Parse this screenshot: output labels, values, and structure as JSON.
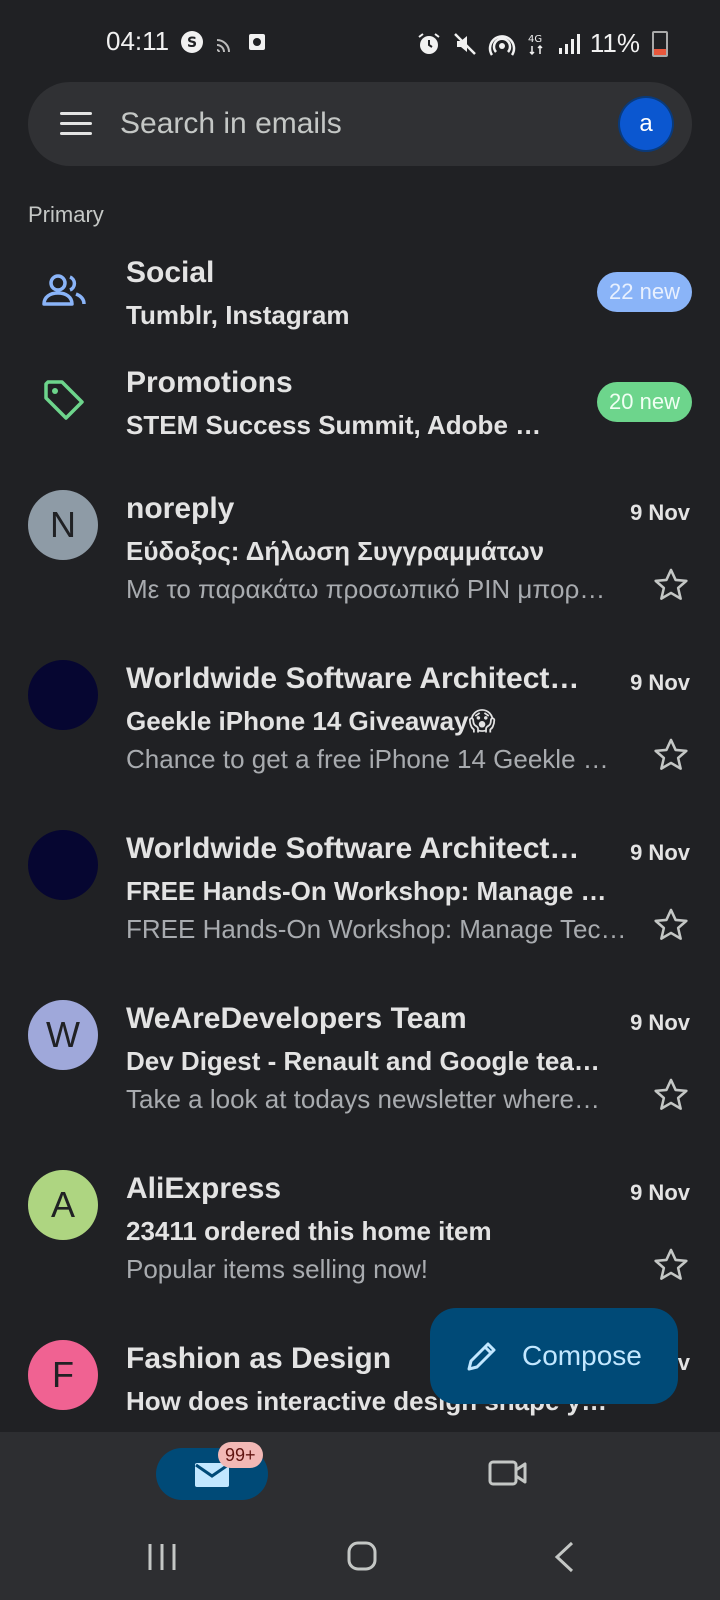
{
  "status_bar": {
    "time": "04:11",
    "battery_text": "11%"
  },
  "search": {
    "placeholder": "Search in emails",
    "avatar_letter": "a"
  },
  "section_label": "Primary",
  "categories": [
    {
      "title": "Social",
      "subtitle": "Tumblr, Instagram",
      "badge": "22 new",
      "badge_color": "#8ab4f8",
      "icon": "people-icon"
    },
    {
      "title": "Promotions",
      "subtitle": "STEM Success Summit, Adobe …",
      "badge": "20 new",
      "badge_color": "#6dd58c",
      "icon": "tag-icon"
    }
  ],
  "emails": [
    {
      "avatar_letter": "N",
      "avatar_color": "#8e9ba6",
      "sender": "noreply",
      "date": "9 Nov",
      "subject": "Εύδοξος: Δήλωση Συγγραμμάτων",
      "snippet": "Με το παρακάτω προσωπικό PIN μπορ…"
    },
    {
      "avatar_letter": "",
      "avatar_color": "#060631",
      "sender": "Worldwide Software Architect…",
      "date": "9 Nov",
      "subject": "Geekle iPhone 14 Giveaway😱",
      "snippet": "Chance to get a free iPhone 14 Geekle …"
    },
    {
      "avatar_letter": "",
      "avatar_color": "#060631",
      "sender": "Worldwide Software Architect…",
      "date": "9 Nov",
      "subject": "FREE Hands-On Workshop: Manage …",
      "snippet": "FREE Hands-On Workshop: Manage Tec…"
    },
    {
      "avatar_letter": "W",
      "avatar_color": "#9fa8da",
      "sender": "WeAreDevelopers Team",
      "date": "9 Nov",
      "subject": "Dev Digest - Renault and Google tea…",
      "snippet": "Take a look at todays newsletter where…"
    },
    {
      "avatar_letter": "A",
      "avatar_color": "#aed581",
      "sender": "AliExpress",
      "date": "9 Nov",
      "subject": "23411 ordered this home item",
      "snippet": "Popular items selling now!"
    },
    {
      "avatar_letter": "F",
      "avatar_color": "#f06292",
      "sender": "Fashion as Design",
      "date": "9 Nov",
      "subject": "How does interactive design shape y…",
      "snippet": ""
    }
  ],
  "compose": {
    "label": "Compose"
  },
  "bottom_nav": {
    "mail_badge": "99+"
  }
}
